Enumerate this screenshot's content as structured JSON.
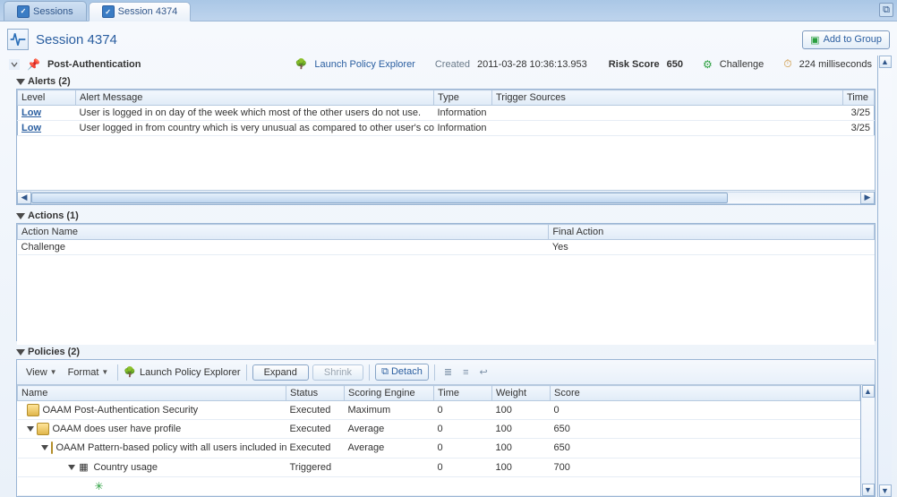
{
  "tabs": {
    "inactive_label": "Sessions",
    "active_label": "Session 4374"
  },
  "page_title": "Session 4374",
  "add_to_group": "Add to Group",
  "info_bar": {
    "stage": "Post-Authentication",
    "launch_policy_explorer": "Launch Policy Explorer",
    "created_label": "Created",
    "created_value": "2011-03-28 10:36:13.953",
    "risk_score_label": "Risk Score",
    "risk_score_value": "650",
    "rule_action": "Challenge",
    "duration": "224 milliseconds"
  },
  "alerts": {
    "title": "Alerts (2)",
    "columns": {
      "level": "Level",
      "msg": "Alert Message",
      "type": "Type",
      "trigger": "Trigger Sources",
      "time": "Time"
    },
    "rows": [
      {
        "level": "Low",
        "msg": "User is logged in on day of the week which most of the other users do not use.",
        "type": "Information",
        "trigger": "",
        "time": "3/25"
      },
      {
        "level": "Low",
        "msg": "User logged in from country which is very unusual as compared to other user's count",
        "type": "Information",
        "trigger": "",
        "time": "3/25"
      }
    ]
  },
  "actions": {
    "title": "Actions (1)",
    "columns": {
      "name": "Action Name",
      "final": "Final Action"
    },
    "rows": [
      {
        "name": "Challenge",
        "final": "Yes"
      }
    ]
  },
  "policies": {
    "title": "Policies (2)",
    "toolbar": {
      "view": "View",
      "format": "Format",
      "launch": "Launch Policy Explorer",
      "expand": "Expand",
      "shrink": "Shrink",
      "detach": "Detach"
    },
    "columns": {
      "name": "Name",
      "status": "Status",
      "engine": "Scoring Engine",
      "time": "Time",
      "weight": "Weight",
      "score": "Score"
    },
    "rows": [
      {
        "indent": 1,
        "expand": false,
        "name": "OAAM Post-Authentication Security",
        "status": "Executed",
        "engine": "Maximum",
        "time": "0",
        "weight": "100",
        "score": "0"
      },
      {
        "indent": 1,
        "expand": true,
        "name": "OAAM does user have profile",
        "status": "Executed",
        "engine": "Average",
        "time": "0",
        "weight": "100",
        "score": "650"
      },
      {
        "indent": 2,
        "expand": true,
        "name": "OAAM Pattern-based policy with all users included in",
        "status": "Executed",
        "engine": "Average",
        "time": "0",
        "weight": "100",
        "score": "650"
      },
      {
        "indent": 3,
        "expand": true,
        "name": "Country usage",
        "status": "Triggered",
        "engine": "",
        "time": "0",
        "weight": "100",
        "score": "700"
      },
      {
        "indent": 4,
        "expand": false,
        "name": "",
        "status": "",
        "engine": "",
        "time": "",
        "weight": "",
        "score": ""
      }
    ]
  }
}
